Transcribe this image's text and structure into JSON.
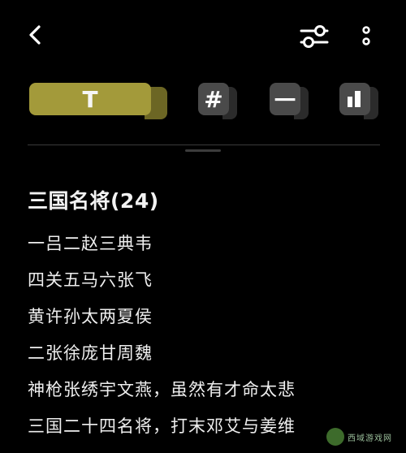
{
  "toolbar": {
    "text_button_label": "T",
    "hash_button_label": "#",
    "dash_button_label": "一",
    "active_color": "#a39a3a",
    "inactive_color": "#4a4a4a"
  },
  "icons": {
    "back": "back-arrow-icon",
    "filter": "filter-sliders-icon",
    "more": "more-vertical-icon"
  },
  "content": {
    "title": "三国名将(24)",
    "lines": [
      "一吕二赵三典韦",
      "四关五马六张飞",
      "黄许孙太两夏侯",
      "二张徐庞甘周魏",
      "神枪张绣宇文燕，虽然有才命太悲",
      "三国二十四名将，打末邓艾与姜维"
    ]
  },
  "watermark": {
    "text": "西域游戏网"
  }
}
